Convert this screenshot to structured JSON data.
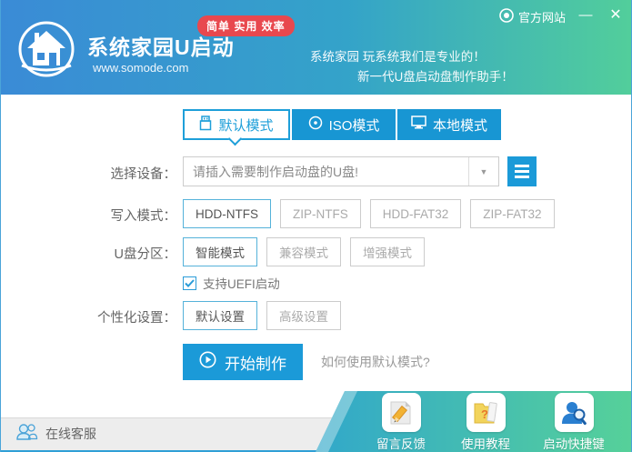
{
  "header": {
    "app_title": "系统家园U启动",
    "website": "www.somode.com",
    "badge": "简单 实用 效率",
    "slogan_line1": "系统家园 玩系统我们是专业的！",
    "slogan_line2": "新一代U盘启动盘制作助手！",
    "official_site_label": "官方网站",
    "minimize_glyph": "—",
    "close_glyph": "✕"
  },
  "tabs": {
    "default_mode": "默认模式",
    "iso_mode": "ISO模式",
    "local_mode": "本地模式"
  },
  "form": {
    "device_label": "选择设备：",
    "device_placeholder": "请插入需要制作启动盘的U盘!",
    "dropdown_arrow_glyph": "▼",
    "write_mode_label": "写入模式：",
    "write_modes": [
      "HDD-NTFS",
      "ZIP-NTFS",
      "HDD-FAT32",
      "ZIP-FAT32"
    ],
    "write_mode_selected": "HDD-NTFS",
    "partition_label": "U盘分区：",
    "partition_modes": [
      "智能模式",
      "兼容模式",
      "增强模式"
    ],
    "partition_selected": "智能模式",
    "uefi_label": "支持UEFI启动",
    "uefi_checked": true,
    "personalize_label": "个性化设置：",
    "personalize_options": [
      "默认设置",
      "高级设置"
    ],
    "personalize_selected": "默认设置",
    "start_button": "开始制作",
    "help_text": "如何使用默认模式?"
  },
  "footer": {
    "online_service": "在线客服",
    "feedback": "留言反馈",
    "tutorial": "使用教程",
    "hotkey": "启动快捷键"
  },
  "colors": {
    "primary_blue": "#1b9ad8",
    "tab_blue": "#1896d3",
    "header_gradient_start": "#3a8bd6",
    "header_gradient_end": "#52ce9b",
    "badge_red": "#e8484e",
    "accent_gradient_start": "#31a7cb",
    "accent_gradient_end": "#56d199",
    "statusbar_gray": "#ededed"
  }
}
